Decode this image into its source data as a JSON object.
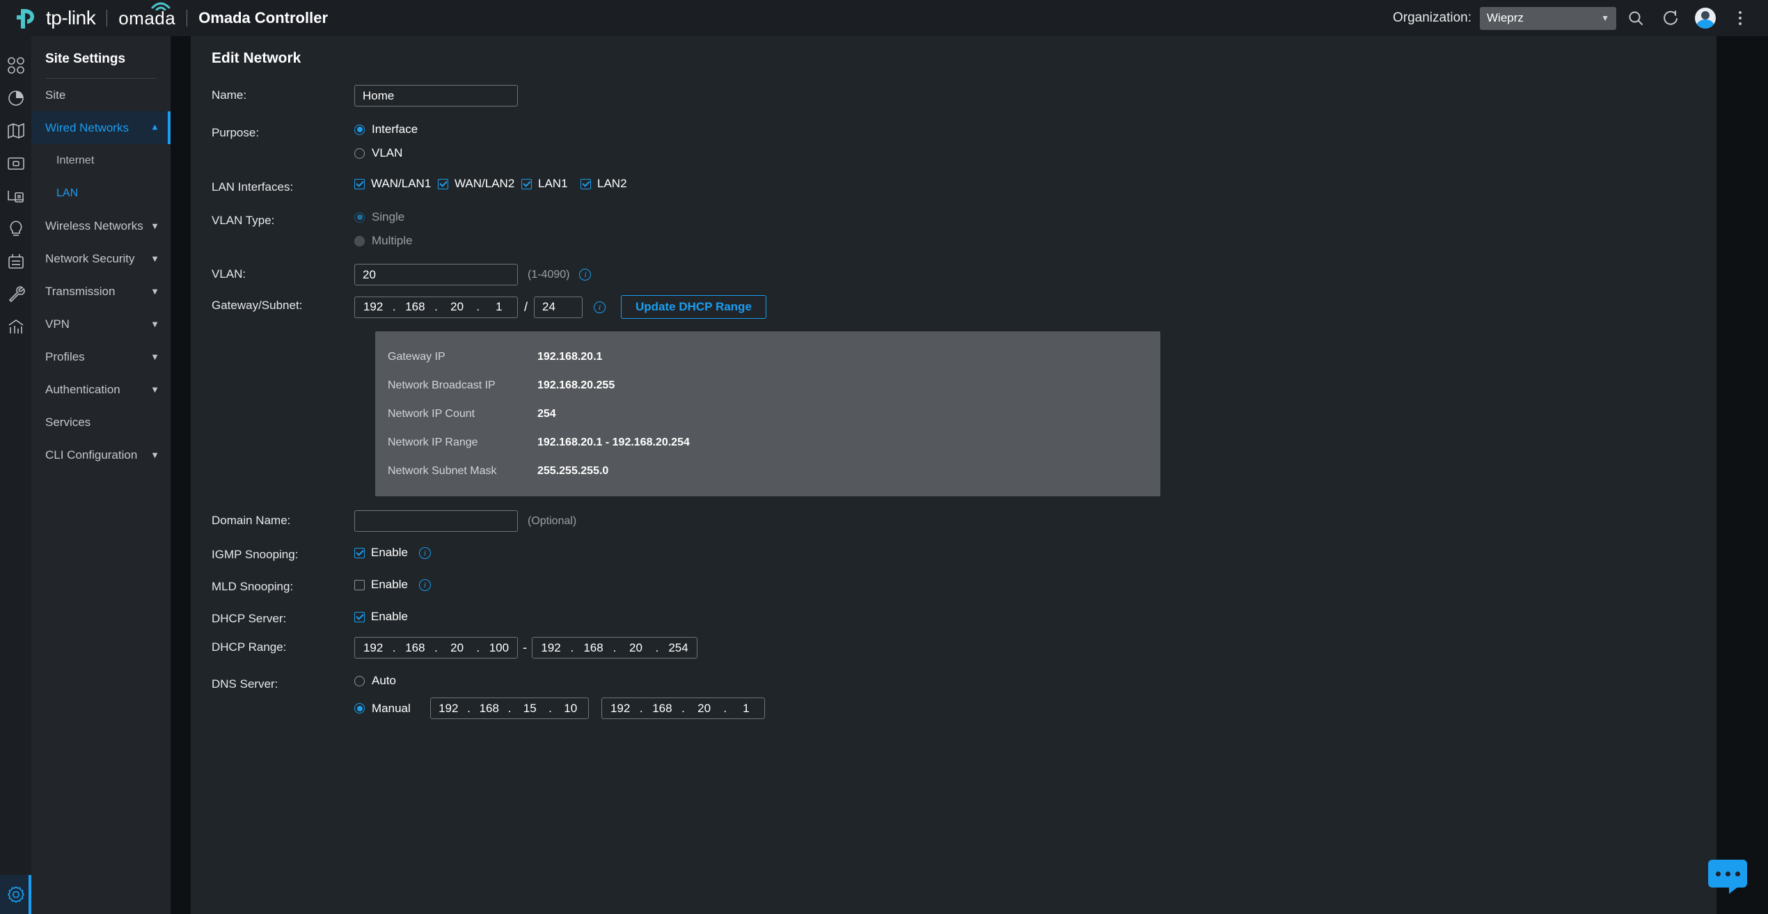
{
  "header": {
    "brand_tp": "tp-link",
    "brand_omada": "omada",
    "app_title": "Omada Controller",
    "org_label": "Organization:",
    "org_value": "Wieprz",
    "icons": [
      "search-icon",
      "refresh-icon",
      "avatar",
      "more-vertical-icon"
    ]
  },
  "rail": {
    "items": [
      "dashboard-icon",
      "statistics-icon",
      "map-icon",
      "devices-icon",
      "clients-icon",
      "insight-icon",
      "log-icon",
      "tools-icon",
      "analytics-icon"
    ],
    "bottom": "settings-gear-icon"
  },
  "sidebar": {
    "title": "Site Settings",
    "items": [
      {
        "label": "Site",
        "type": "item",
        "state": "normal"
      },
      {
        "label": "Wired Networks",
        "type": "group",
        "state": "active",
        "chevron": "chevron-up"
      },
      {
        "label": "Internet",
        "type": "sub",
        "state": "normal"
      },
      {
        "label": "LAN",
        "type": "sub",
        "state": "selected"
      },
      {
        "label": "Wireless Networks",
        "type": "group",
        "state": "normal",
        "chevron": "chevron-down"
      },
      {
        "label": "Network Security",
        "type": "group",
        "state": "normal",
        "chevron": "chevron-down"
      },
      {
        "label": "Transmission",
        "type": "group",
        "state": "normal",
        "chevron": "chevron-down"
      },
      {
        "label": "VPN",
        "type": "group",
        "state": "normal",
        "chevron": "chevron-down"
      },
      {
        "label": "Profiles",
        "type": "group",
        "state": "normal",
        "chevron": "chevron-down"
      },
      {
        "label": "Authentication",
        "type": "group",
        "state": "normal",
        "chevron": "chevron-down"
      },
      {
        "label": "Services",
        "type": "item",
        "state": "normal"
      },
      {
        "label": "CLI Configuration",
        "type": "group",
        "state": "normal",
        "chevron": "chevron-down"
      }
    ]
  },
  "main": {
    "page_title": "Edit Network",
    "labels": {
      "name": "Name:",
      "purpose": "Purpose:",
      "lan_interfaces": "LAN Interfaces:",
      "vlan_type": "VLAN Type:",
      "vlan": "VLAN:",
      "gateway_subnet": "Gateway/Subnet:",
      "domain_name": "Domain Name:",
      "igmp_snooping": "IGMP Snooping:",
      "mld_snooping": "MLD Snooping:",
      "dhcp_server": "DHCP Server:",
      "dhcp_range": "DHCP Range:",
      "dns_server": "DNS Server:"
    },
    "name_value": "Home",
    "purpose": {
      "options": [
        "Interface",
        "VLAN"
      ],
      "selected": "Interface"
    },
    "lan_interfaces": [
      {
        "label": "WAN/LAN1",
        "checked": true
      },
      {
        "label": "WAN/LAN2",
        "checked": true
      },
      {
        "label": "LAN1",
        "checked": true
      },
      {
        "label": "LAN2",
        "checked": true
      }
    ],
    "vlan_type": {
      "options": [
        "Single",
        "Multiple"
      ],
      "selected": "Single",
      "disabled": true
    },
    "vlan_value": "20",
    "vlan_hint": "(1-4090)",
    "gateway": {
      "octets": [
        "192",
        "168",
        "20",
        "1"
      ],
      "mask": "24",
      "separator": "/"
    },
    "update_dhcp_button": "Update DHCP Range",
    "info_panel": [
      {
        "key": "Gateway IP",
        "value": "192.168.20.1"
      },
      {
        "key": "Network Broadcast IP",
        "value": "192.168.20.255"
      },
      {
        "key": "Network IP Count",
        "value": "254"
      },
      {
        "key": "Network IP Range",
        "value": "192.168.20.1 - 192.168.20.254"
      },
      {
        "key": "Network Subnet Mask",
        "value": "255.255.255.0"
      }
    ],
    "domain_name_value": "",
    "domain_name_hint": "(Optional)",
    "enable_label": "Enable",
    "igmp_snooping_checked": true,
    "mld_snooping_checked": false,
    "dhcp_server_checked": true,
    "dhcp_range": {
      "start": [
        "192",
        "168",
        "20",
        "100"
      ],
      "end": [
        "192",
        "168",
        "20",
        "254"
      ],
      "separator": "-"
    },
    "dns_server": {
      "options": [
        "Auto",
        "Manual"
      ],
      "selected": "Manual",
      "primary": [
        "192",
        "168",
        "15",
        "10"
      ],
      "secondary": [
        "192",
        "168",
        "20",
        "1"
      ]
    }
  },
  "chat_widget": "chat-bubble-icon",
  "colors": {
    "accent": "#1b9df0",
    "brand_teal": "#4ac5cb",
    "top_bar": "#1b1f23",
    "sidebar": "#22262b",
    "main_bg": "#202529",
    "info_panel": "#55595d"
  }
}
